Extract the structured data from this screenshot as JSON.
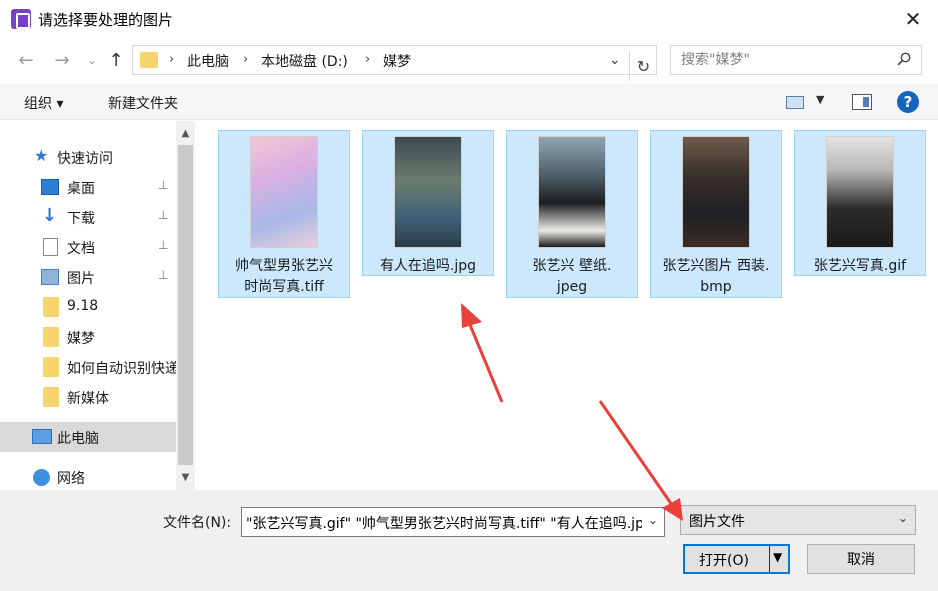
{
  "window": {
    "title": "请选择要处理的图片",
    "close": "✕"
  },
  "address": {
    "breadcrumbs": [
      "此电脑",
      "本地磁盘 (D:)",
      "媒梦"
    ],
    "separator": "›",
    "dropdown": "⌄",
    "refresh": "↻"
  },
  "search": {
    "placeholder": "搜索\"媒梦\""
  },
  "nav_buttons": {
    "back": "←",
    "forward": "→",
    "recent": "⌄",
    "up": "↑"
  },
  "toolbar": {
    "organize": "组织 ▾",
    "new_folder": "新建文件夹",
    "view_dropdown": "▼",
    "help": "?"
  },
  "sidebar": {
    "items": [
      {
        "label": "快速访问",
        "icon": "star-icon",
        "pinned": false
      },
      {
        "label": "桌面",
        "icon": "desktop-icon",
        "pinned": true
      },
      {
        "label": "下载",
        "icon": "download-icon",
        "pinned": true
      },
      {
        "label": "文档",
        "icon": "document-icon",
        "pinned": true
      },
      {
        "label": "图片",
        "icon": "pictures-icon",
        "pinned": true
      },
      {
        "label": "9.18",
        "icon": "folder-icon",
        "pinned": false
      },
      {
        "label": "媒梦",
        "icon": "folder-icon",
        "pinned": false
      },
      {
        "label": "如何自动识别快递",
        "icon": "folder-icon",
        "pinned": false
      },
      {
        "label": "新媒体",
        "icon": "folder-icon",
        "pinned": false
      },
      {
        "label": "此电脑",
        "icon": "computer-icon",
        "pinned": false,
        "selected": true
      },
      {
        "label": "网络",
        "icon": "network-icon",
        "pinned": false
      }
    ],
    "pin_glyph": "📌"
  },
  "files": [
    {
      "name_line1": "帅气型男张艺兴",
      "name_line2": "时尚写真.tiff",
      "selected": true
    },
    {
      "name_line1": "有人在追吗.jpg",
      "name_line2": "",
      "selected": true
    },
    {
      "name_line1": "张艺兴 壁纸.",
      "name_line2": "jpeg",
      "selected": true
    },
    {
      "name_line1": "张艺兴图片 西装.",
      "name_line2": "bmp",
      "selected": true
    },
    {
      "name_line1": "张艺兴写真.gif",
      "name_line2": "",
      "selected": true
    }
  ],
  "bottom": {
    "filename_label": "文件名(N):",
    "filename_value": "\"张艺兴写真.gif\" \"帅气型男张艺兴时尚写真.tiff\" \"有人在追吗.jpg\"",
    "filetype_value": "图片文件",
    "open_label": "打开(O)",
    "cancel_label": "取消",
    "dropdown": "⌄"
  },
  "colors": {
    "selection_fill": "#cce8ff",
    "selection_border": "#99d1ff",
    "annotation_arrow": "#e8413c",
    "primary_button_border": "#0078d7"
  }
}
